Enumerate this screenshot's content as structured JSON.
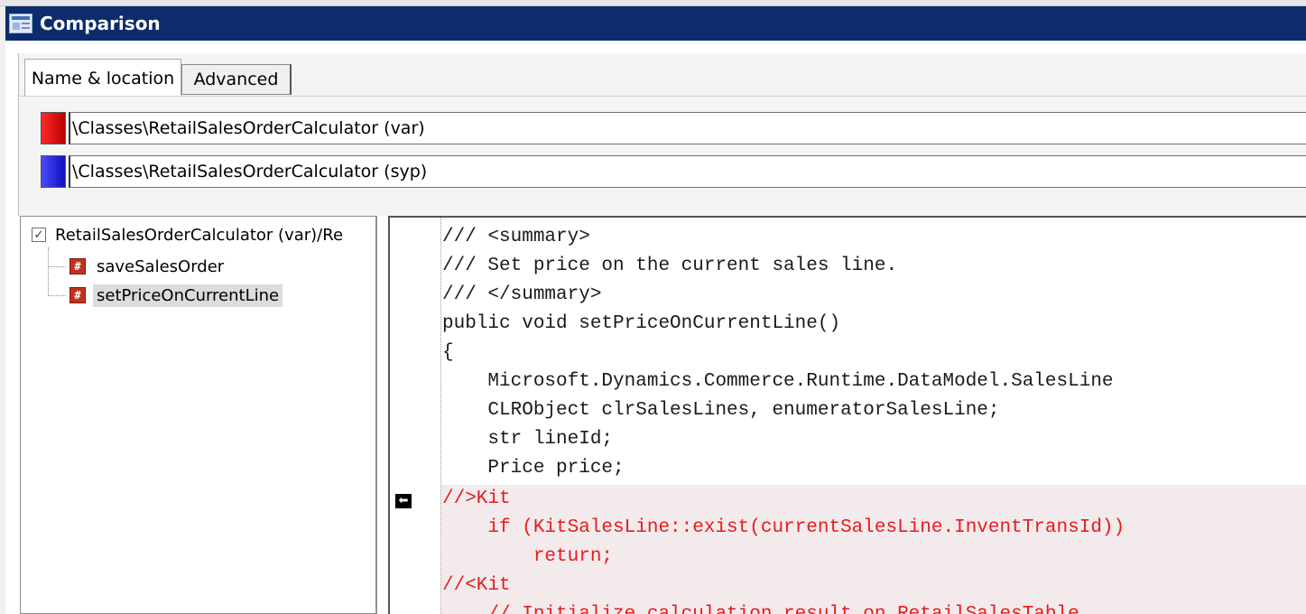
{
  "window": {
    "title": "Comparison"
  },
  "tabs": [
    {
      "label": "Name & location",
      "active": true
    },
    {
      "label": "Advanced",
      "active": false
    }
  ],
  "paths": {
    "first": {
      "color": "#e00000",
      "value": "\\Classes\\RetailSalesOrderCalculator (var)"
    },
    "second": {
      "color": "#2020e0",
      "value": "\\Classes\\RetailSalesOrderCalculator (syp)"
    }
  },
  "tree": {
    "root_label": "RetailSalesOrderCalculator (var)/Re",
    "root_checked": true,
    "items": [
      {
        "label": "saveSalesOrder",
        "icon": "method-diff-icon",
        "selected": false
      },
      {
        "label": "setPriceOnCurrentLine",
        "icon": "method-diff-icon",
        "selected": true
      }
    ]
  },
  "code": {
    "lines": [
      {
        "text": "/// <summary>",
        "changed": false
      },
      {
        "text": "/// Set price on the current sales line.",
        "changed": false
      },
      {
        "text": "/// </summary>",
        "changed": false
      },
      {
        "text": "public void setPriceOnCurrentLine()",
        "changed": false
      },
      {
        "text": "{",
        "changed": false
      },
      {
        "text": "    Microsoft.Dynamics.Commerce.Runtime.DataModel.SalesLine",
        "changed": false
      },
      {
        "text": "    CLRObject clrSalesLines, enumeratorSalesLine;",
        "changed": false
      },
      {
        "text": "    str lineId;",
        "changed": false
      },
      {
        "text": "    Price price;",
        "changed": false
      },
      {
        "text": "//>Kit",
        "changed": true
      },
      {
        "text": "    if (KitSalesLine::exist(currentSalesLine.InventTransId))",
        "changed": true
      },
      {
        "text": "        return;",
        "changed": true
      },
      {
        "text": "//<Kit",
        "changed": true
      },
      {
        "text": "    // Initialize calculation result on RetailSalesTable",
        "changed": true
      }
    ],
    "diff_marker": "arrow-left-icon",
    "diff_color": "#e51c1c"
  }
}
